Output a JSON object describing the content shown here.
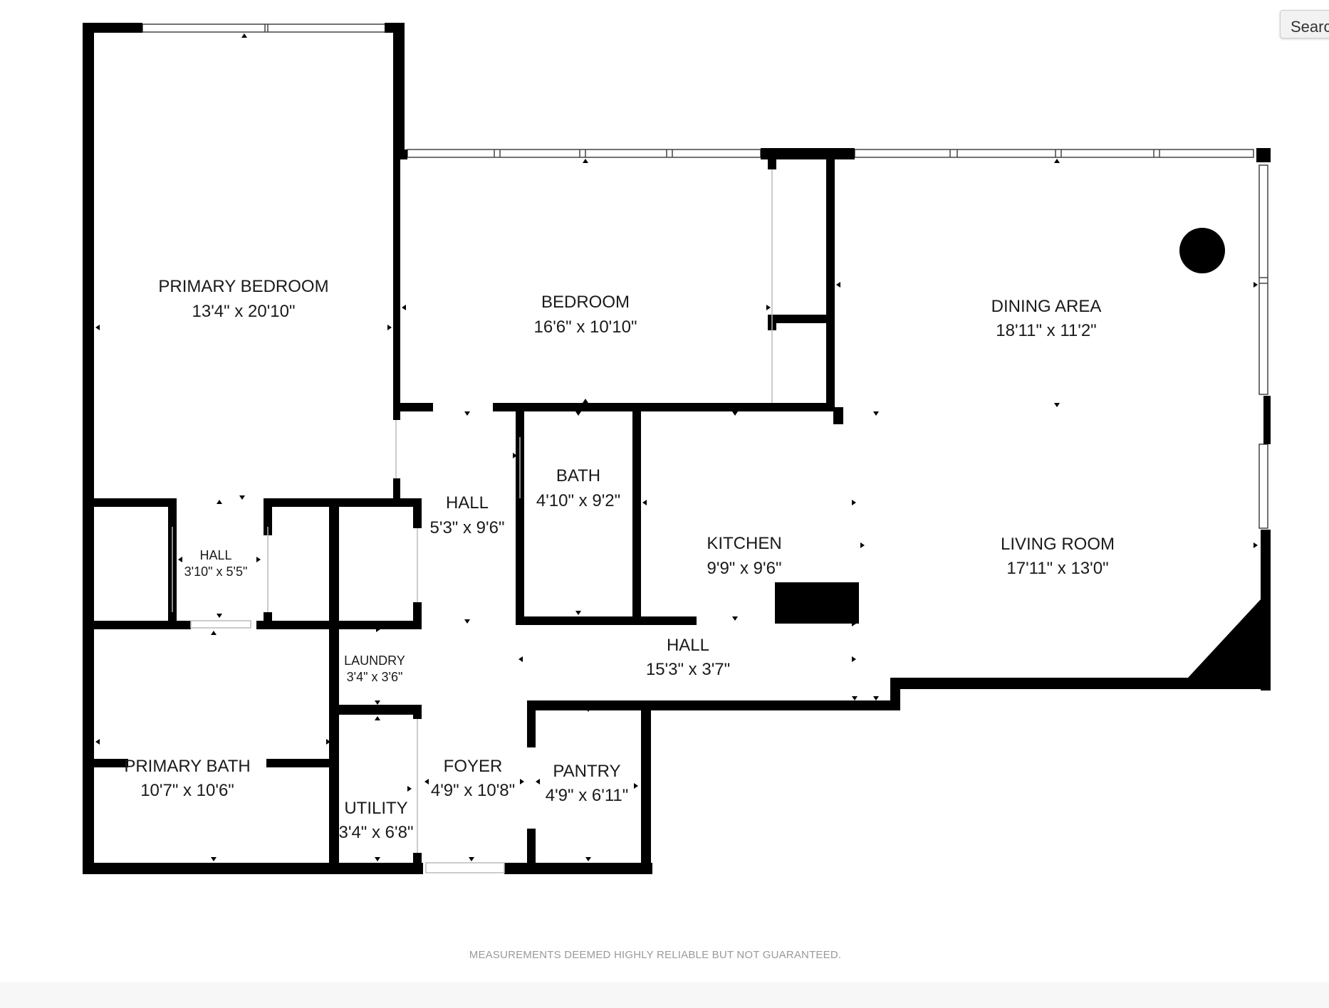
{
  "floorplan": {
    "rooms": [
      {
        "id": "primary-bedroom",
        "name": "PRIMARY BEDROOM",
        "dims": "13'4\" x 20'10\""
      },
      {
        "id": "bedroom",
        "name": "BEDROOM",
        "dims": "16'6\" x 10'10\""
      },
      {
        "id": "dining-area",
        "name": "DINING AREA",
        "dims": "18'11\" x 11'2\""
      },
      {
        "id": "hall-main",
        "name": "HALL",
        "dims": "5'3\" x 9'6\""
      },
      {
        "id": "bath",
        "name": "BATH",
        "dims": "4'10\" x 9'2\""
      },
      {
        "id": "kitchen",
        "name": "KITCHEN",
        "dims": "9'9\" x 9'6\""
      },
      {
        "id": "living-room",
        "name": "LIVING ROOM",
        "dims": "17'11\" x 13'0\""
      },
      {
        "id": "hall-small",
        "name": "HALL",
        "dims": "3'10\" x 5'5\""
      },
      {
        "id": "laundry",
        "name": "LAUNDRY",
        "dims": "3'4\" x 3'6\""
      },
      {
        "id": "hall-long",
        "name": "HALL",
        "dims": "15'3\" x 3'7\""
      },
      {
        "id": "primary-bath",
        "name": "PRIMARY BATH",
        "dims": "10'7\" x 10'6\""
      },
      {
        "id": "foyer",
        "name": "FOYER",
        "dims": "4'9\" x 10'8\""
      },
      {
        "id": "pantry",
        "name": "PANTRY",
        "dims": "4'9\" x 6'11\""
      },
      {
        "id": "utility",
        "name": "UTILITY",
        "dims": "3'4\" x 6'8\""
      }
    ],
    "disclaimer": "MEASUREMENTS DEEMED HIGHLY RELIABLE BUT NOT GUARANTEED."
  },
  "toolbar": {
    "search_label": "Search"
  }
}
